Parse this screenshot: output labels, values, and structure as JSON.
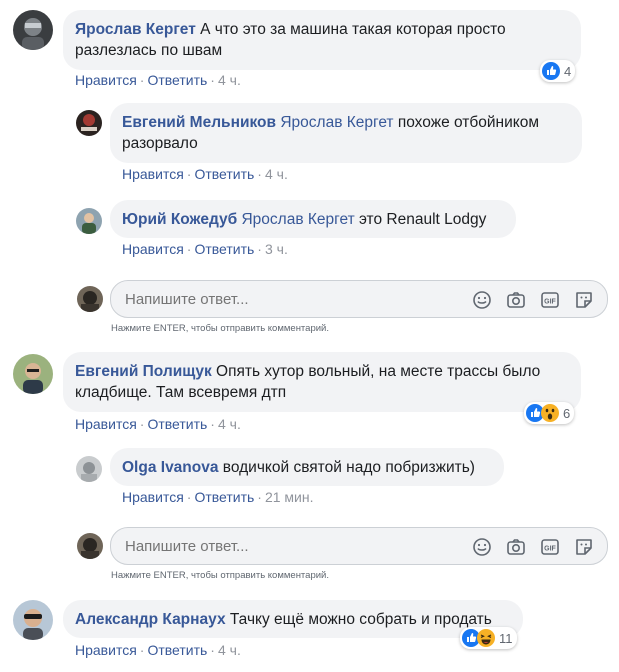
{
  "comments": [
    {
      "author": "Ярослав Кергет",
      "text": "А что это за машина такая которая просто разлезлась по швам",
      "like_label": "Нравится",
      "reply_label": "Ответить",
      "time": "4 ч.",
      "reaction_count": "4",
      "reactions": [
        "like-icon"
      ],
      "replies": [
        {
          "author": "Евгений Мельников",
          "mention": "Ярослав Кергет",
          "text": "похоже отбойником разорвало",
          "like_label": "Нравится",
          "reply_label": "Ответить",
          "time": "4 ч."
        },
        {
          "author": "Юрий Кожедуб",
          "mention": "Ярослав Кергет",
          "text": "это Renault Lodgy",
          "like_label": "Нравится",
          "reply_label": "Ответить",
          "time": "3 ч."
        }
      ],
      "reply_box": {
        "placeholder": "Напишите ответ...",
        "hint": "Нажмите ENTER, чтобы отправить комментарий."
      }
    },
    {
      "author": "Евгений Полищук",
      "text": "Опять хутор вольный, на месте трассы было кладбище. Там всевремя дтп",
      "like_label": "Нравится",
      "reply_label": "Ответить",
      "time": "4 ч.",
      "reaction_count": "6",
      "reactions": [
        "like-icon",
        "wow-icon"
      ],
      "replies": [
        {
          "author": "Olga Ivanova",
          "text": "водичкой святой надо побризжить)",
          "like_label": "Нравится",
          "reply_label": "Ответить",
          "time": "21 мин."
        }
      ],
      "reply_box": {
        "placeholder": "Напишите ответ...",
        "hint": "Нажмите ENTER, чтобы отправить комментарий."
      }
    },
    {
      "author": "Александр Карнаух",
      "text": "Тачку ещё можно собрать и продать",
      "like_label": "Нравится",
      "reply_label": "Ответить",
      "time": "4 ч.",
      "reaction_count": "11",
      "reactions": [
        "like-icon",
        "haha-icon"
      ]
    }
  ],
  "colors": {
    "link": "#385898",
    "bubble": "#f2f3f5",
    "meta": "#90949c",
    "like_blue": "#1877f2",
    "reaction_yellow": "#f7b125"
  }
}
